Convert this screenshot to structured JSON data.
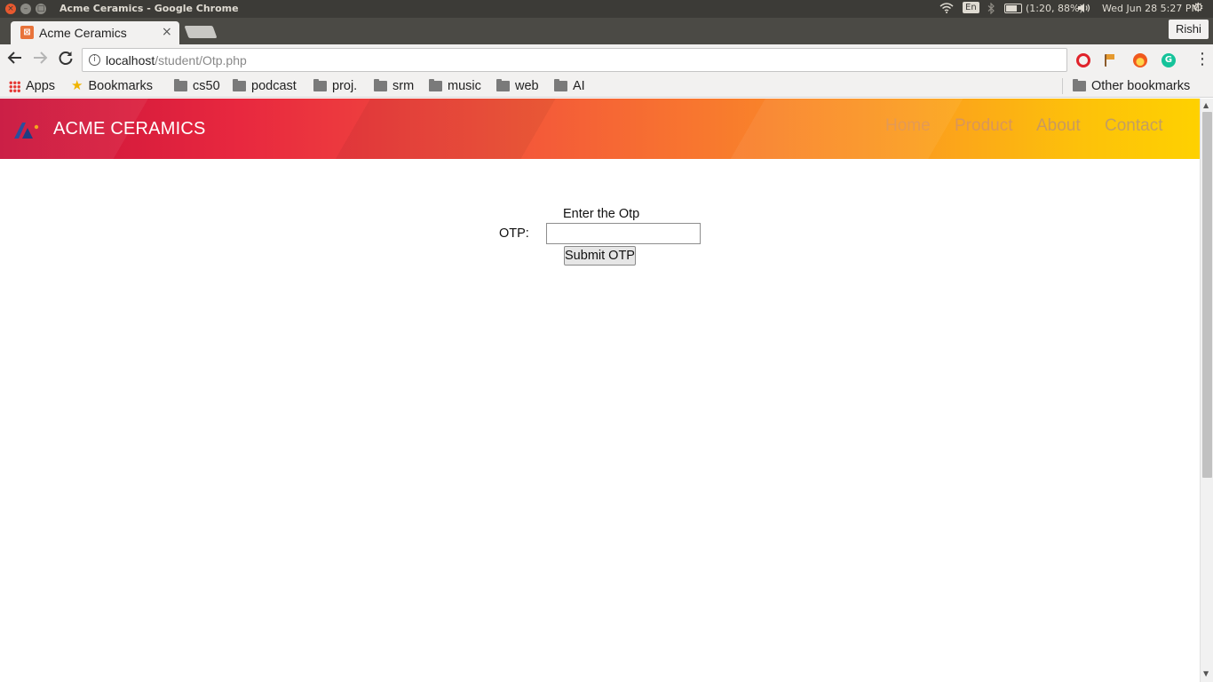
{
  "os": {
    "window_title": "Acme Ceramics - Google Chrome",
    "close_glyph": "×",
    "min_glyph": "–",
    "max_glyph": "□",
    "lang": "En",
    "battery": "(1:20, 88%)",
    "clock": "Wed Jun 28  5:27 PM"
  },
  "browser": {
    "tab_title": "Acme Ceramics",
    "tab_close": "×",
    "profile_name": "Rishi",
    "url_host": "localhost",
    "url_path": "/student/Otp.php",
    "icons": {
      "back": "arrow-left-icon",
      "forward": "arrow-right-icon",
      "reload": "reload-icon",
      "info": "info-icon",
      "menu": "three-dots-icon"
    }
  },
  "bookmarks": {
    "items": [
      {
        "label": "Apps",
        "icon": "apps-icon"
      },
      {
        "label": "Bookmarks",
        "icon": "star-icon"
      },
      {
        "label": "cs50",
        "icon": "folder-icon"
      },
      {
        "label": "podcast",
        "icon": "folder-icon"
      },
      {
        "label": "proj.",
        "icon": "folder-icon"
      },
      {
        "label": "srm",
        "icon": "folder-icon"
      },
      {
        "label": "music",
        "icon": "folder-icon"
      },
      {
        "label": "web",
        "icon": "folder-icon"
      },
      {
        "label": "AI",
        "icon": "folder-icon"
      }
    ],
    "other": "Other bookmarks"
  },
  "site": {
    "brand": "ACME CERAMICS",
    "nav": [
      "Home",
      "Product",
      "About",
      "Contact"
    ],
    "colors": {
      "gradient_start": "#c8113a",
      "gradient_end": "#fed100"
    }
  },
  "otp_form": {
    "heading": "Enter the Otp",
    "label": "OTP:",
    "input_value": "",
    "submit_label": "Submit OTP"
  }
}
